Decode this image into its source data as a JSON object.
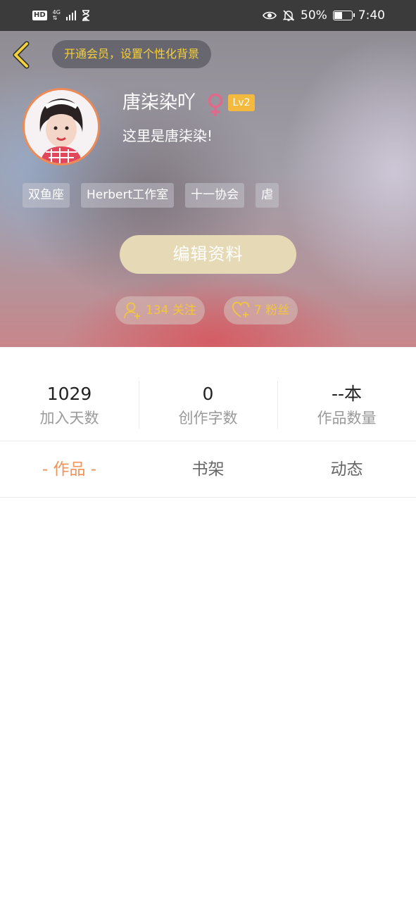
{
  "status_bar": {
    "hd": "HD",
    "network_top": "4G",
    "network_bottom": "⇅",
    "battery_text": "50%",
    "battery_level": 0.5,
    "time": "7:40",
    "icons": [
      "hd-icon",
      "signal-icon",
      "hourglass-icon",
      "eye-icon",
      "mute-bell-icon",
      "battery-icon"
    ]
  },
  "header": {
    "vip_banner": "开通会员，设置个性化背景",
    "nickname": "唐柒染吖",
    "gender": "female",
    "level": "Lv2",
    "bio": "这里是唐柒染!",
    "tags": [
      "双鱼座",
      "Herbert工作室",
      "十一协会",
      "虐"
    ],
    "edit_button": "编辑资料",
    "following": "134 关注",
    "fans": "7 粉丝",
    "colors": {
      "accent": "#f2c63a",
      "edit_button": "#e6dab6",
      "level_badge": "#f4b93f",
      "avatar_border": "#ee8a55"
    }
  },
  "stats": [
    {
      "value": "1029",
      "label": "加入天数"
    },
    {
      "value": "0",
      "label": "创作字数"
    },
    {
      "value": "--本",
      "label": "作品数量"
    }
  ],
  "tabs": [
    {
      "label": "- 作品 -",
      "active": true
    },
    {
      "label": "书架",
      "active": false
    },
    {
      "label": "动态",
      "active": false
    }
  ],
  "colors": {
    "active_tab": "#f0925a",
    "status_bar": "#3b3b3b"
  }
}
